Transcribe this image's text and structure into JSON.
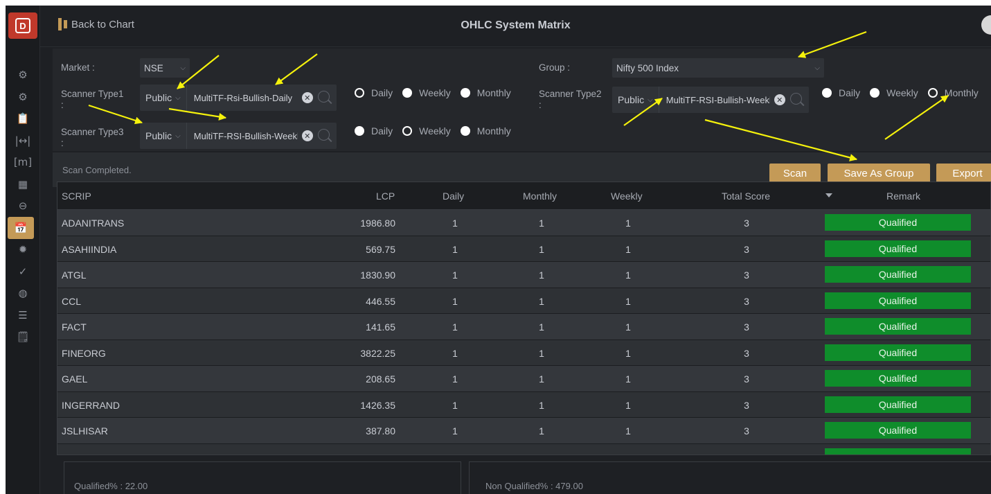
{
  "app": {
    "title": "OHLC System Matrix",
    "back_label": "Back to Chart"
  },
  "rail": {
    "icons": [
      "settings-icon",
      "settings-icon",
      "clipboard-icon",
      "range-icon",
      "bracket-m-icon",
      "grid-icon",
      "expand-icon",
      "calendar-icon",
      "bulb-icon",
      "tick-icon",
      "palette-icon",
      "list-icon",
      "clipboard-check-icon"
    ],
    "glyphs": [
      "⚙",
      "⚙",
      "📋",
      "|↔|",
      "[m]",
      "▦",
      "⊖",
      "📅",
      "✹",
      "✓",
      "◍",
      "☰",
      "🗒"
    ],
    "active_index": 7
  },
  "filters": {
    "market_label": "Market :",
    "market_value": "NSE",
    "group_label": "Group :",
    "group_value": "Nifty 500 Index",
    "scanner1": {
      "label": "Scanner Type1",
      "colon": ":",
      "visibility": "Public",
      "value": "MultiTF-Rsi-Bullish-Daily",
      "options": [
        "Daily",
        "Weekly",
        "Monthly"
      ],
      "selected": "Daily"
    },
    "scanner2": {
      "label": "Scanner Type2",
      "colon": ":",
      "visibility": "Public",
      "value": "MultiTF-RSI-Bullish-Weekly",
      "options": [
        "Daily",
        "Weekly",
        "Monthly"
      ],
      "selected": "Monthly"
    },
    "scanner3": {
      "label": "Scanner Type3",
      "colon": ":",
      "visibility": "Public",
      "value": "MultiTF-RSI-Bullish-Weekly",
      "options": [
        "Daily",
        "Weekly",
        "Monthly"
      ],
      "selected": "Weekly"
    }
  },
  "actions": {
    "status": "Scan Completed.",
    "scan_label": "Scan",
    "save_group_label": "Save As Group",
    "export_label": "Export"
  },
  "table": {
    "columns": [
      "SCRIP",
      "LCP",
      "Daily",
      "Monthly",
      "Weekly",
      "Total Score",
      "Remark"
    ],
    "rows": [
      {
        "scrip": "ADANITRANS",
        "lcp": "1986.80",
        "daily": "1",
        "monthly": "1",
        "weekly": "1",
        "total": "3",
        "remark": "Qualified"
      },
      {
        "scrip": "ASAHIINDIA",
        "lcp": "569.75",
        "daily": "1",
        "monthly": "1",
        "weekly": "1",
        "total": "3",
        "remark": "Qualified"
      },
      {
        "scrip": "ATGL",
        "lcp": "1830.90",
        "daily": "1",
        "monthly": "1",
        "weekly": "1",
        "total": "3",
        "remark": "Qualified"
      },
      {
        "scrip": "CCL",
        "lcp": "446.55",
        "daily": "1",
        "monthly": "1",
        "weekly": "1",
        "total": "3",
        "remark": "Qualified"
      },
      {
        "scrip": "FACT",
        "lcp": "141.65",
        "daily": "1",
        "monthly": "1",
        "weekly": "1",
        "total": "3",
        "remark": "Qualified"
      },
      {
        "scrip": "FINEORG",
        "lcp": "3822.25",
        "daily": "1",
        "monthly": "1",
        "weekly": "1",
        "total": "3",
        "remark": "Qualified"
      },
      {
        "scrip": "GAEL",
        "lcp": "208.65",
        "daily": "1",
        "monthly": "1",
        "weekly": "1",
        "total": "3",
        "remark": "Qualified"
      },
      {
        "scrip": "INGERRAND",
        "lcp": "1426.35",
        "daily": "1",
        "monthly": "1",
        "weekly": "1",
        "total": "3",
        "remark": "Qualified"
      },
      {
        "scrip": "JSLHISAR",
        "lcp": "387.80",
        "daily": "1",
        "monthly": "1",
        "weekly": "1",
        "total": "3",
        "remark": "Qualified"
      }
    ]
  },
  "summary": {
    "qualified": "Qualified% : 22.00",
    "non_qualified": "Non Qualified% : 479.00"
  },
  "colors": {
    "accent": "#c49a57",
    "qualified": "#0f8d2b",
    "annotation": "#f5f20c"
  }
}
